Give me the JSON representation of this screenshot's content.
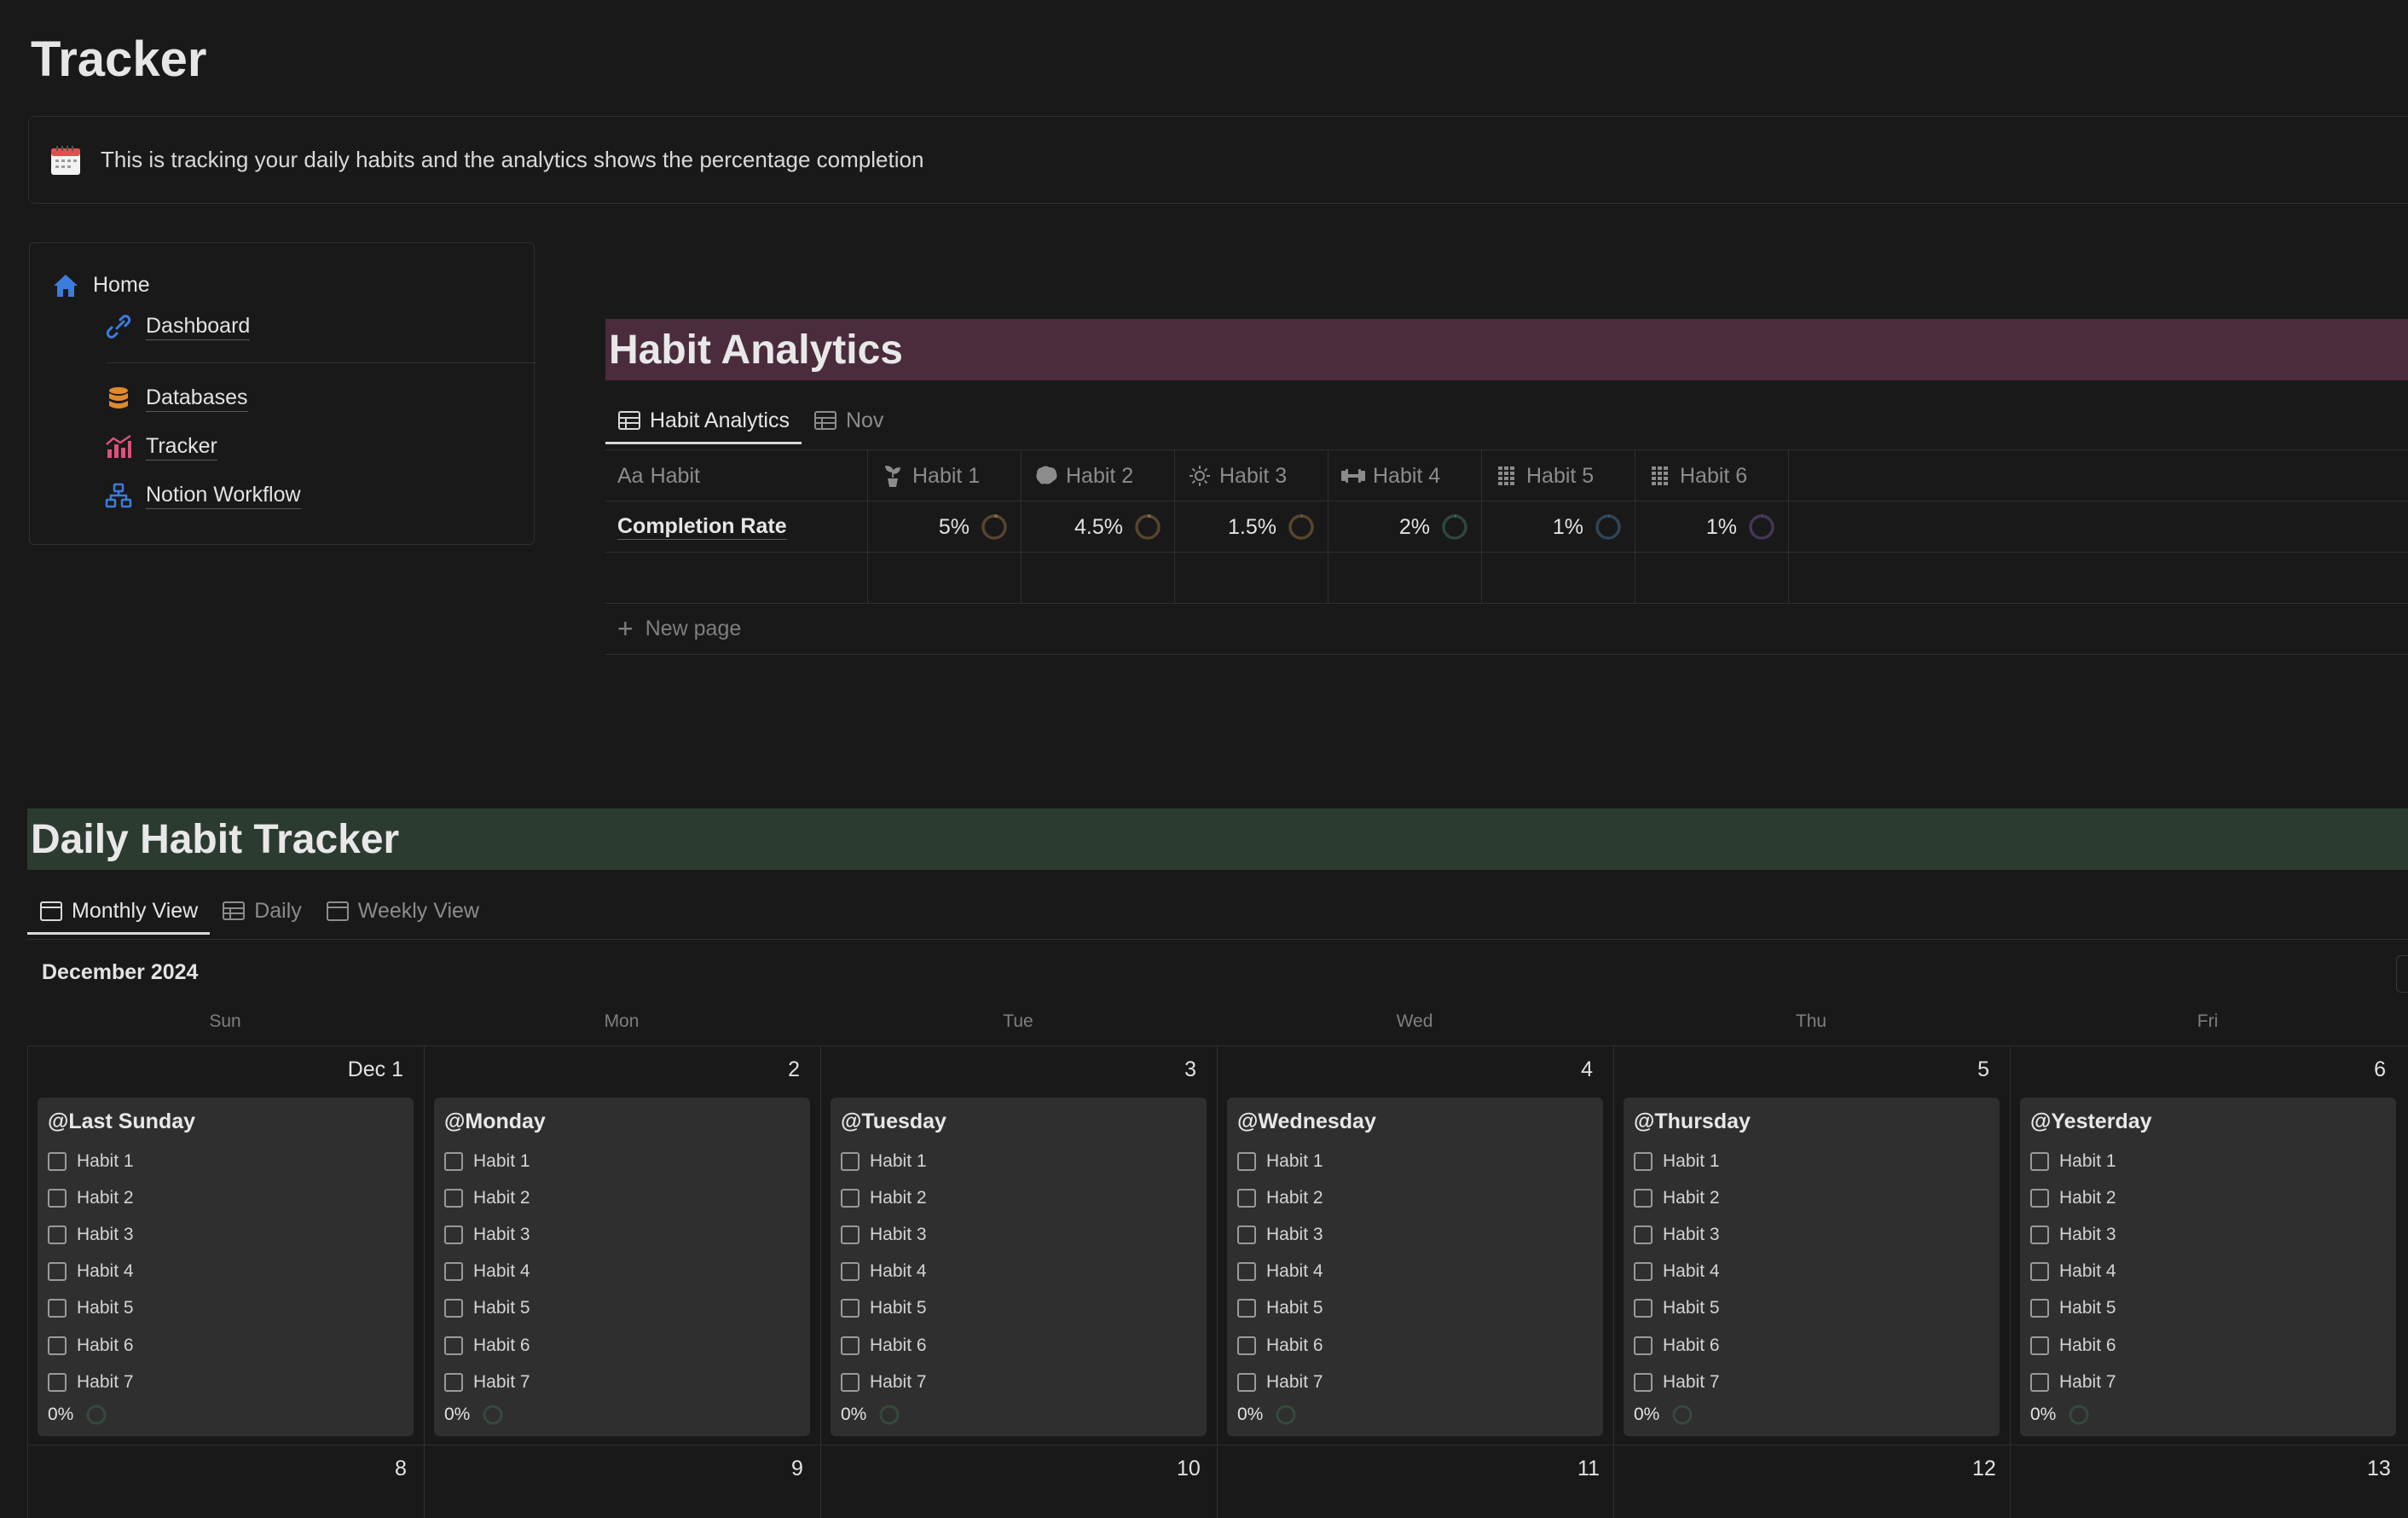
{
  "page": {
    "title": "Tracker",
    "callout_text": "This is tracking your daily habits and the analytics shows the percentage completion"
  },
  "nav": {
    "home": "Home",
    "dashboard": "Dashboard",
    "databases": "Databases",
    "tracker": "Tracker",
    "workflow": "Notion Workflow"
  },
  "analytics": {
    "banner": "Habit Analytics",
    "tabs": [
      "Habit Analytics",
      "Nov"
    ],
    "columns": [
      "Habit",
      "Habit 1",
      "Habit 2",
      "Habit 3",
      "Habit 4",
      "Habit 5",
      "Habit 6"
    ],
    "column_prefix": "Aa",
    "row_name": "Completion Rate",
    "values": [
      "5%",
      "4.5%",
      "1.5%",
      "2%",
      "1%",
      "1%"
    ],
    "ring_fractions": [
      0.05,
      0.045,
      0.015,
      0.02,
      0.01,
      0.01
    ],
    "ring_colors": [
      "#8a6a3f",
      "#8a6a3f",
      "#8a6a3f",
      "#3e6f5a",
      "#3f6a8a",
      "#6a4f8a"
    ],
    "new_page": "New page"
  },
  "daily": {
    "banner": "Daily Habit Tracker",
    "tabs": [
      "Monthly View",
      "Daily",
      "Weekly View"
    ],
    "month": "December 2024",
    "weekdays": [
      "Sun",
      "Mon",
      "Tue",
      "Wed",
      "Thu",
      "Fri"
    ],
    "days": [
      {
        "num": "Dec 1",
        "title": "@Last Sunday"
      },
      {
        "num": "2",
        "title": "@Monday"
      },
      {
        "num": "3",
        "title": "@Tuesday"
      },
      {
        "num": "4",
        "title": "@Wednesday"
      },
      {
        "num": "5",
        "title": "@Thursday"
      },
      {
        "num": "6",
        "title": "@Yesterday"
      }
    ],
    "habits": [
      "Habit 1",
      "Habit 2",
      "Habit 3",
      "Habit 4",
      "Habit 5",
      "Habit 6",
      "Habit 7"
    ],
    "percent": "0%",
    "next_week": [
      "8",
      "9",
      "10",
      "11",
      "12",
      "13"
    ]
  }
}
